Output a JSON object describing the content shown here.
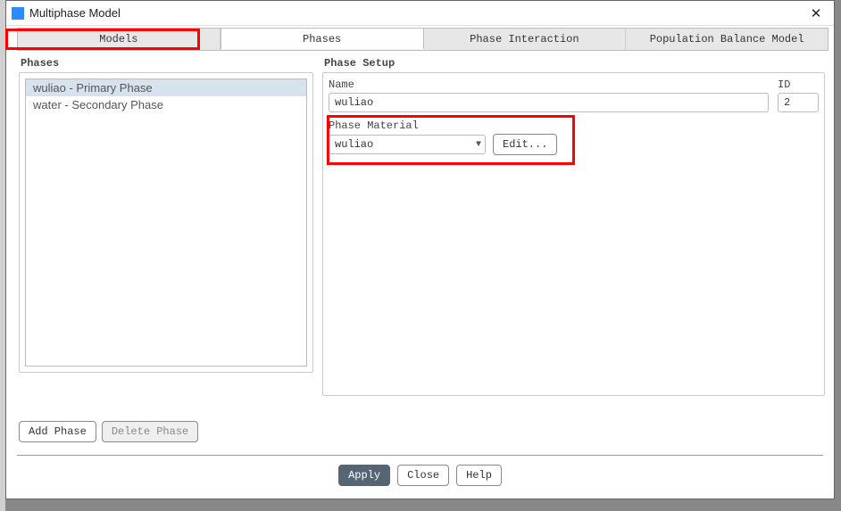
{
  "window": {
    "title": "Multiphase Model"
  },
  "tabs": {
    "models": "Models",
    "phases": "Phases",
    "interaction": "Phase Interaction",
    "population": "Population Balance Model"
  },
  "left": {
    "heading": "Phases",
    "items": [
      {
        "label": "wuliao - Primary Phase",
        "selected": true
      },
      {
        "label": "water - Secondary Phase",
        "selected": false
      }
    ],
    "add_phase": "Add Phase",
    "delete_phase": "Delete Phase"
  },
  "right": {
    "heading": "Phase Setup",
    "name_label": "Name",
    "name_value": "wuliao",
    "id_label": "ID",
    "id_value": "2",
    "material_label": "Phase Material",
    "material_value": "wuliao",
    "edit": "Edit..."
  },
  "footer": {
    "apply": "Apply",
    "close": "Close",
    "help": "Help"
  }
}
